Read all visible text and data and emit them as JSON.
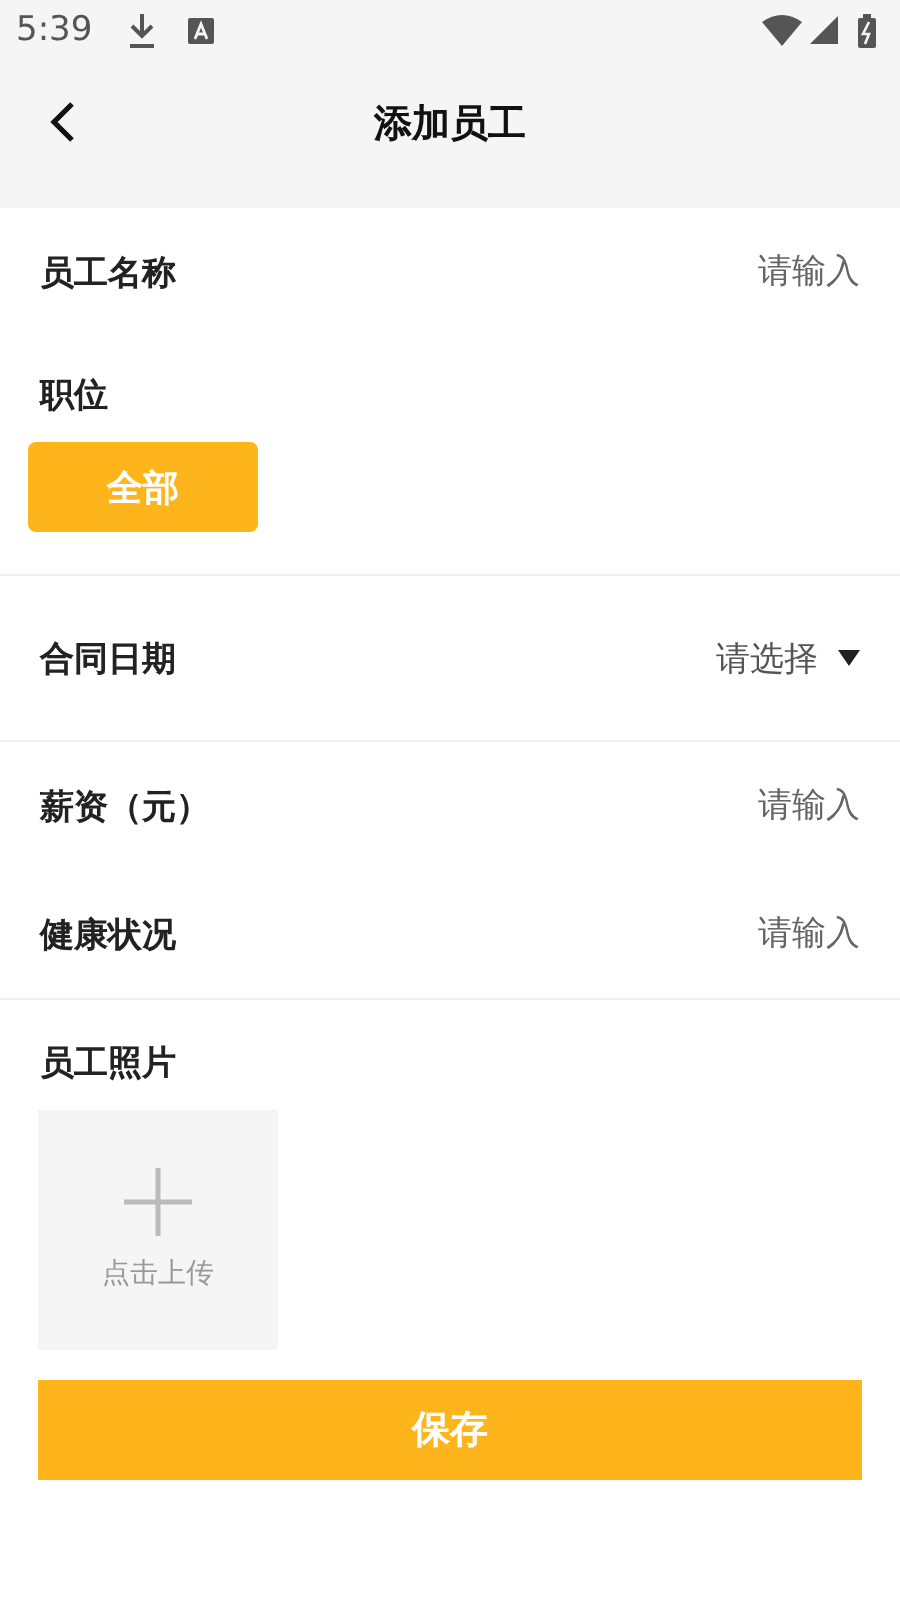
{
  "status_bar": {
    "time": "5:39"
  },
  "app_bar": {
    "title": "添加员工"
  },
  "sections": [
    {
      "fields": [
        {
          "kind": "input",
          "label": "员工名称",
          "placeholder": "请输入"
        },
        {
          "kind": "chips",
          "label": "职位",
          "options": [
            {
              "label": "全部",
              "selected": true
            }
          ]
        }
      ]
    },
    {
      "fields": [
        {
          "kind": "select",
          "label": "合同日期",
          "placeholder": "请选择"
        }
      ]
    },
    {
      "fields": [
        {
          "kind": "input",
          "label": "薪资（元）",
          "placeholder": "请输入"
        },
        {
          "kind": "input",
          "label": "健康状况",
          "placeholder": "请输入"
        }
      ]
    },
    {
      "fields": [
        {
          "kind": "photo",
          "label": "员工照片",
          "upload_label": "点击上传"
        }
      ]
    }
  ],
  "save_button": "保存"
}
